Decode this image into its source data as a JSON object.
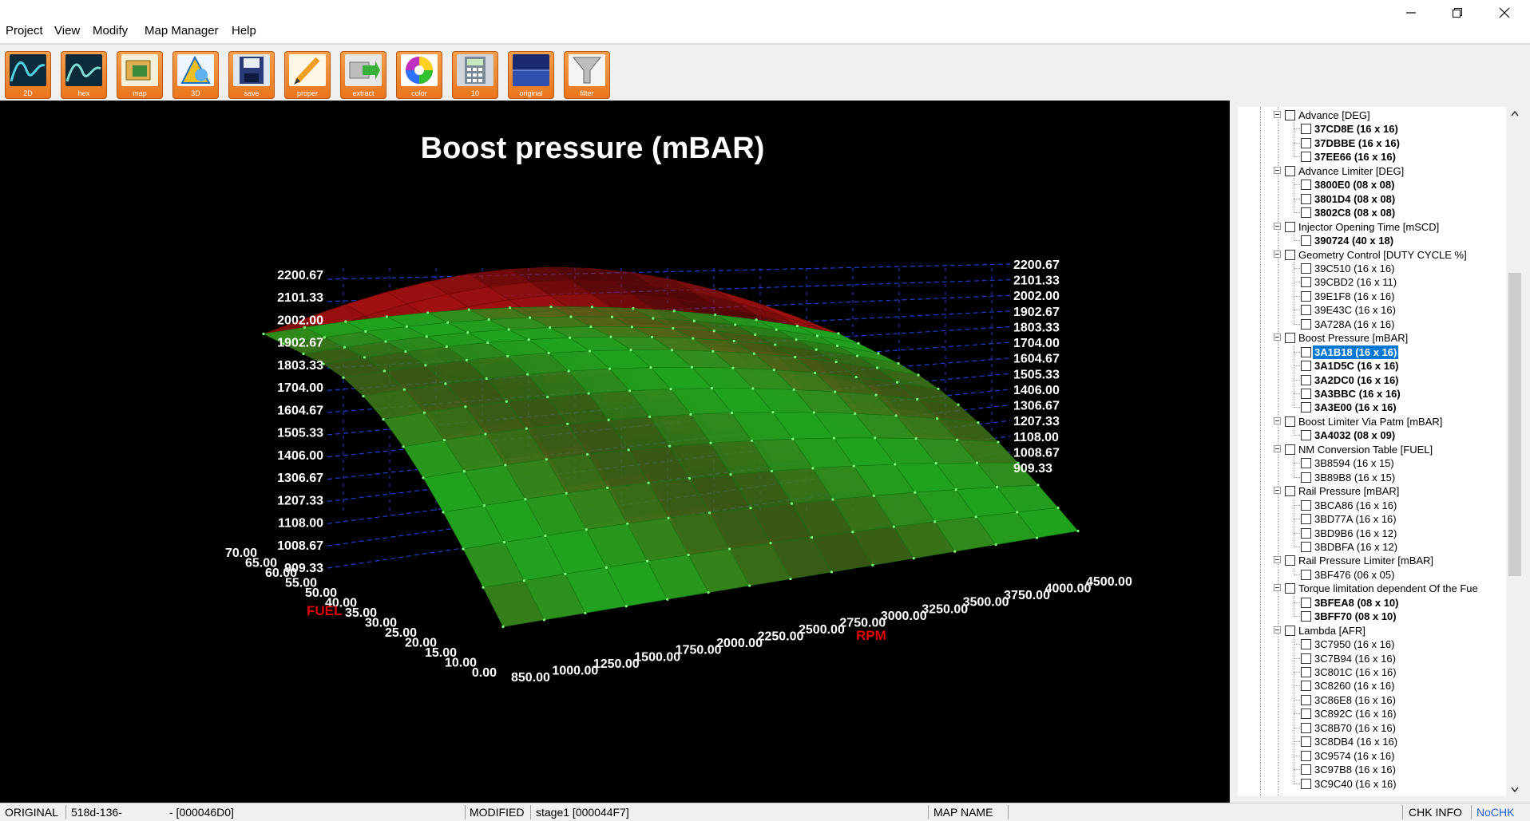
{
  "menu": [
    "Project",
    "View",
    "Modify",
    "Map Manager",
    "Help"
  ],
  "window_controls": {
    "minimize": "minimize-icon",
    "restore": "restore-icon",
    "close": "close-icon"
  },
  "toolbar": [
    {
      "label": "2D",
      "icon": "2d-graph-icon"
    },
    {
      "label": "hex",
      "icon": "hex-graph-icon"
    },
    {
      "label": "map",
      "icon": "map-icon"
    },
    {
      "label": "3D",
      "icon": "3d-icon"
    },
    {
      "label": "save",
      "icon": "save-icon"
    },
    {
      "label": "proper",
      "icon": "pencil-icon"
    },
    {
      "label": "extract",
      "icon": "extract-icon"
    },
    {
      "label": "color",
      "icon": "color-wheel-icon"
    },
    {
      "label": "10",
      "icon": "calculator-icon"
    },
    {
      "label": "original",
      "icon": "original-icon"
    },
    {
      "label": "filter",
      "icon": "filter-icon"
    }
  ],
  "chart_data": {
    "type": "surface3d",
    "title": "Boost pressure (mBAR)",
    "x_axis_label": "RPM",
    "y_axis_label": "FUEL",
    "rpm_ticks": [
      "850.00",
      "1000.00",
      "1250.00",
      "1500.00",
      "1750.00",
      "2000.00",
      "2250.00",
      "2500.00",
      "2750.00",
      "3000.00",
      "3250.00",
      "3500.00",
      "3750.00",
      "4000.00",
      "4500.00"
    ],
    "fuel_ticks": [
      "0.00",
      "10.00",
      "15.00",
      "20.00",
      "25.00",
      "30.00",
      "35.00",
      "40.00",
      "50.00",
      "55.00",
      "60.00",
      "65.00",
      "70.00"
    ],
    "z_ticks": [
      "909.33",
      "1008.67",
      "1108.00",
      "1207.33",
      "1306.67",
      "1406.00",
      "1505.33",
      "1604.67",
      "1704.00",
      "1803.33",
      "1902.67",
      "2002.00",
      "2101.33",
      "2200.67"
    ],
    "z_range": [
      909.33,
      2200.67
    ],
    "colors": {
      "original_surface": "#1fa31f",
      "modified_surface": "#a01010",
      "grid": "#1a3fd0",
      "labels": "#ffffff",
      "axis_title": "#e00000"
    }
  },
  "tree": {
    "groups": [
      {
        "label": "Advance [DEG]",
        "items": [
          {
            "t": "37CD8E (16 x 16)",
            "b": true
          },
          {
            "t": "37DBBE (16 x 16)",
            "b": true
          },
          {
            "t": "37EE66 (16 x 16)",
            "b": true
          }
        ]
      },
      {
        "label": "Advance Limiter [DEG]",
        "items": [
          {
            "t": "3800E0 (08 x 08)",
            "b": true
          },
          {
            "t": "3801D4 (08 x 08)",
            "b": true
          },
          {
            "t": "3802C8 (08 x 08)",
            "b": true
          }
        ]
      },
      {
        "label": "Injector Opening Time [mSCD]",
        "items": [
          {
            "t": "390724 (40 x 18)",
            "b": true
          }
        ]
      },
      {
        "label": "Geometry Control [DUTY CYCLE %]",
        "items": [
          {
            "t": "39C510 (16 x 16)",
            "b": false
          },
          {
            "t": "39CBD2 (16 x 11)",
            "b": false
          },
          {
            "t": "39E1F8 (16 x 16)",
            "b": false
          },
          {
            "t": "39E43C (16 x 16)",
            "b": false
          },
          {
            "t": "3A728A (16 x 16)",
            "b": false
          }
        ]
      },
      {
        "label": "Boost Pressure [mBAR]",
        "items": [
          {
            "t": "3A1B18 (16 x 16)",
            "b": true,
            "sel": true
          },
          {
            "t": "3A1D5C (16 x 16)",
            "b": true
          },
          {
            "t": "3A2DC0 (16 x 16)",
            "b": true
          },
          {
            "t": "3A3BBC (16 x 16)",
            "b": true
          },
          {
            "t": "3A3E00 (16 x 16)",
            "b": true
          }
        ]
      },
      {
        "label": "Boost Limiter Via Patm [mBAR]",
        "items": [
          {
            "t": "3A4032 (08 x 09)",
            "b": true
          }
        ]
      },
      {
        "label": "NM Conversion Table [FUEL]",
        "items": [
          {
            "t": "3B8594 (16 x 15)",
            "b": false
          },
          {
            "t": "3B89B8 (16 x 15)",
            "b": false
          }
        ]
      },
      {
        "label": "Rail Pressure [mBAR]",
        "items": [
          {
            "t": "3BCA86 (16 x 16)",
            "b": false
          },
          {
            "t": "3BD77A (16 x 16)",
            "b": false
          },
          {
            "t": "3BD9B6 (16 x 12)",
            "b": false
          },
          {
            "t": "3BDBFA (16 x 12)",
            "b": false
          }
        ]
      },
      {
        "label": "Rail Pressure Limiter [mBAR]",
        "items": [
          {
            "t": "3BF476 (06 x 05)",
            "b": false
          }
        ]
      },
      {
        "label": "Torque limitation dependent Of the Fue",
        "items": [
          {
            "t": "3BFEA8 (08 x 10)",
            "b": true
          },
          {
            "t": "3BFF70 (08 x 10)",
            "b": true
          }
        ]
      },
      {
        "label": "Lambda [AFR]",
        "items": [
          {
            "t": "3C7950 (16 x 16)",
            "b": false
          },
          {
            "t": "3C7B94 (16 x 16)",
            "b": false
          },
          {
            "t": "3C801C (16 x 16)",
            "b": false
          },
          {
            "t": "3C8260 (16 x 16)",
            "b": false
          },
          {
            "t": "3C86E8 (16 x 16)",
            "b": false
          },
          {
            "t": "3C892C (16 x 16)",
            "b": false
          },
          {
            "t": "3C8B70 (16 x 16)",
            "b": false
          },
          {
            "t": "3C8DB4 (16 x 16)",
            "b": false
          },
          {
            "t": "3C9574 (16 x 16)",
            "b": false
          },
          {
            "t": "3C97B8 (16 x 16)",
            "b": false
          },
          {
            "t": "3C9C40 (16 x 16)",
            "b": false
          }
        ]
      }
    ]
  },
  "status": {
    "original_label": "ORIGINAL",
    "original_file": "518d-136-",
    "original_addr": "- [000046D0]",
    "modified_label": "MODIFIED",
    "modified_file": "stage1 [000044F7]",
    "map_name_label": "MAP NAME",
    "chk_info": "CHK INFO",
    "nochk": "NoCHK",
    "nochk_color": "#1f5fd8"
  }
}
